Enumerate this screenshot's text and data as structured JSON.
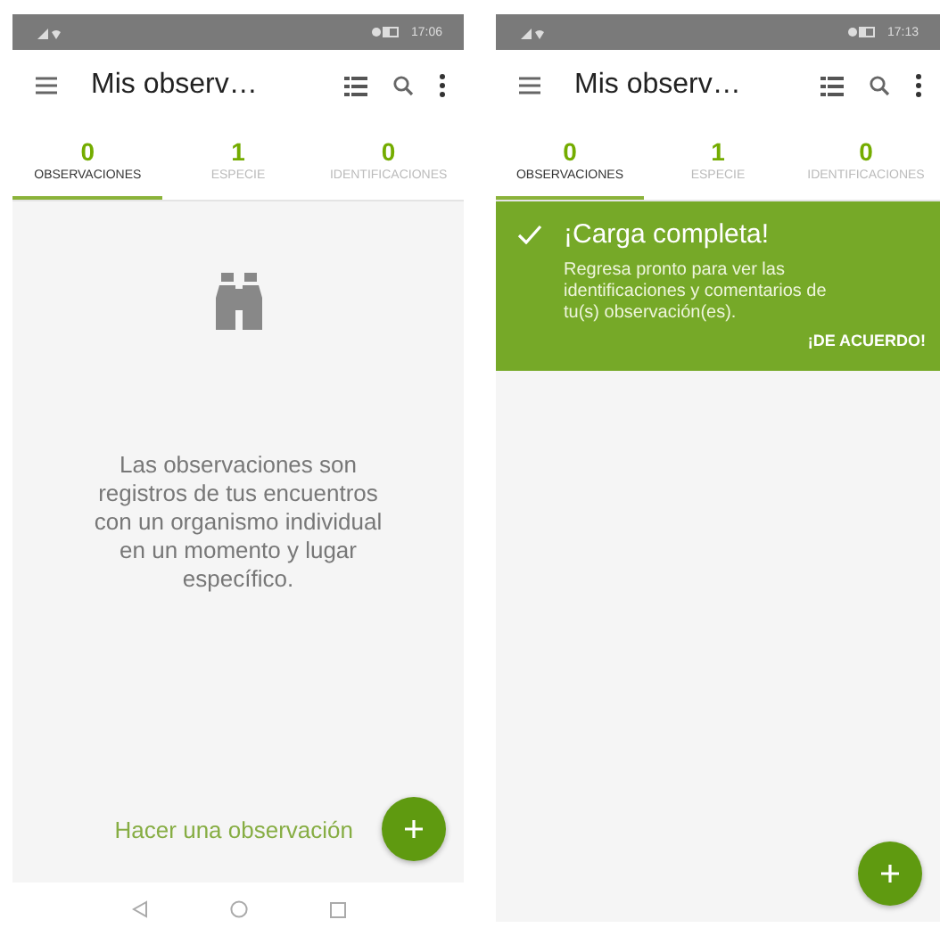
{
  "screens": [
    {
      "status_bar": {
        "time": "17:06"
      },
      "toolbar": {
        "title": "Mis observ…"
      },
      "tabs": [
        {
          "count": "0",
          "label": "OBSERVACIONES",
          "selected": true
        },
        {
          "count": "1",
          "label": "ESPECIE",
          "selected": false
        },
        {
          "count": "0",
          "label": "IDENTIFICACIONES",
          "selected": false
        }
      ],
      "empty_state": {
        "text": "Las observaciones son registros de tus encuentros con un organismo individual en un momento y lugar específico."
      },
      "action_label": "Hacer una observación",
      "nav_bar": true
    },
    {
      "status_bar": {
        "time": "17:13"
      },
      "toolbar": {
        "title": "Mis observ…"
      },
      "tabs": [
        {
          "count": "0",
          "label": "OBSERVACIONES",
          "selected": true
        },
        {
          "count": "1",
          "label": "ESPECIE",
          "selected": false
        },
        {
          "count": "0",
          "label": "IDENTIFICACIONES",
          "selected": false
        }
      ],
      "banner": {
        "title": "¡Carga completa!",
        "text": "Regresa pronto para ver las identificaciones y comentarios de tu(s) observación(es).",
        "button": "¡DE ACUERDO!"
      }
    }
  ]
}
